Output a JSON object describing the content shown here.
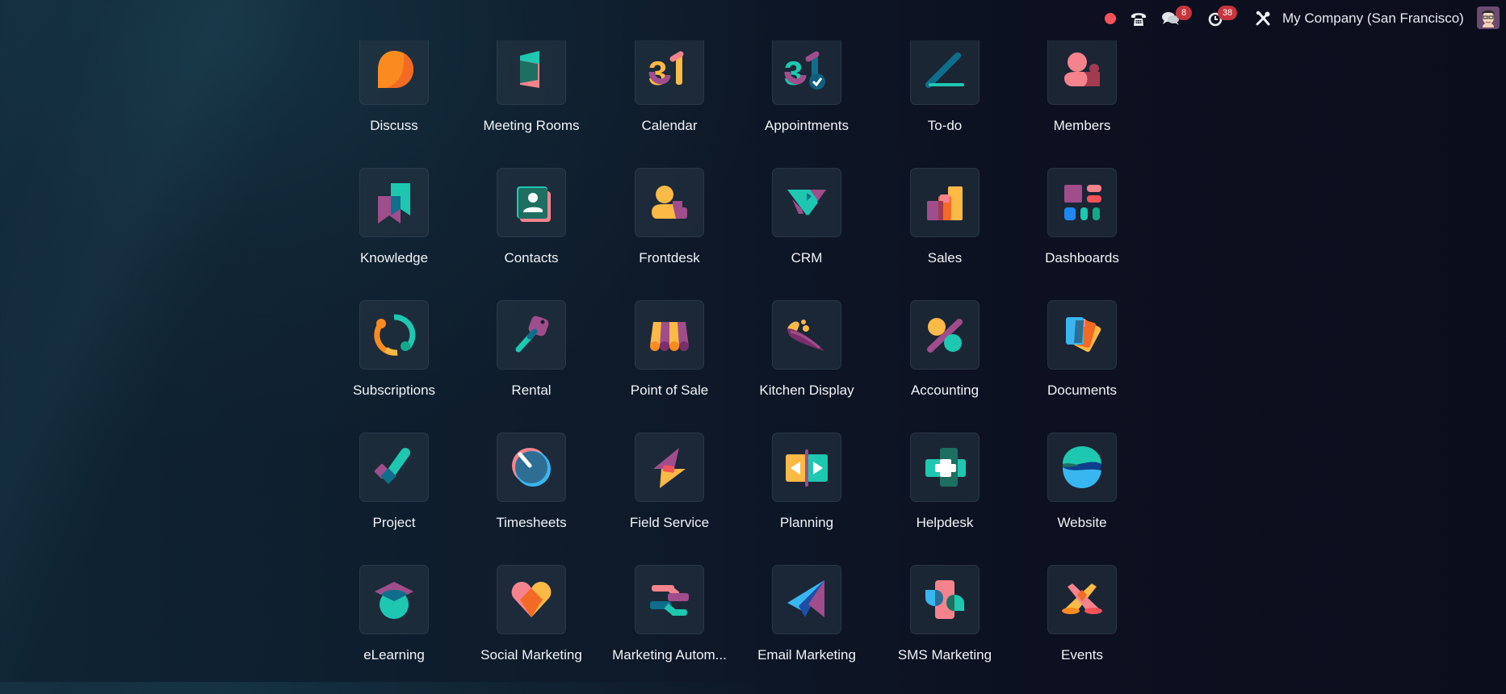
{
  "topbar": {
    "recording_indicator": "record-dot",
    "phone_icon": "phone-icon",
    "messages_badge": "8",
    "activities_badge": "38",
    "company": "My Company (San Francisco)",
    "colors": {
      "record": "#f5525a",
      "badge": "#c7353c"
    }
  },
  "apps": [
    {
      "label": "Discuss",
      "icon": "discuss-icon"
    },
    {
      "label": "Meeting Rooms",
      "icon": "meeting-rooms-icon"
    },
    {
      "label": "Calendar",
      "icon": "calendar-icon",
      "glyph": "31"
    },
    {
      "label": "Appointments",
      "icon": "appointments-icon",
      "glyph": "31"
    },
    {
      "label": "To-do",
      "icon": "todo-icon"
    },
    {
      "label": "Members",
      "icon": "members-icon"
    },
    {
      "label": "Knowledge",
      "icon": "knowledge-icon"
    },
    {
      "label": "Contacts",
      "icon": "contacts-icon"
    },
    {
      "label": "Frontdesk",
      "icon": "frontdesk-icon"
    },
    {
      "label": "CRM",
      "icon": "crm-icon"
    },
    {
      "label": "Sales",
      "icon": "sales-icon"
    },
    {
      "label": "Dashboards",
      "icon": "dashboards-icon"
    },
    {
      "label": "Subscriptions",
      "icon": "subscriptions-icon"
    },
    {
      "label": "Rental",
      "icon": "rental-icon"
    },
    {
      "label": "Point of Sale",
      "icon": "point-of-sale-icon"
    },
    {
      "label": "Kitchen Display",
      "icon": "kitchen-display-icon"
    },
    {
      "label": "Accounting",
      "icon": "accounting-icon"
    },
    {
      "label": "Documents",
      "icon": "documents-icon"
    },
    {
      "label": "Project",
      "icon": "project-icon"
    },
    {
      "label": "Timesheets",
      "icon": "timesheets-icon"
    },
    {
      "label": "Field Service",
      "icon": "field-service-icon"
    },
    {
      "label": "Planning",
      "icon": "planning-icon"
    },
    {
      "label": "Helpdesk",
      "icon": "helpdesk-icon"
    },
    {
      "label": "Website",
      "icon": "website-icon"
    },
    {
      "label": "eLearning",
      "icon": "elearning-icon"
    },
    {
      "label": "Social Marketing",
      "icon": "social-marketing-icon"
    },
    {
      "label": "Marketing Autom...",
      "icon": "marketing-automation-icon"
    },
    {
      "label": "Email Marketing",
      "icon": "email-marketing-icon"
    },
    {
      "label": "SMS Marketing",
      "icon": "sms-marketing-icon"
    },
    {
      "label": "Events",
      "icon": "events-icon"
    }
  ]
}
